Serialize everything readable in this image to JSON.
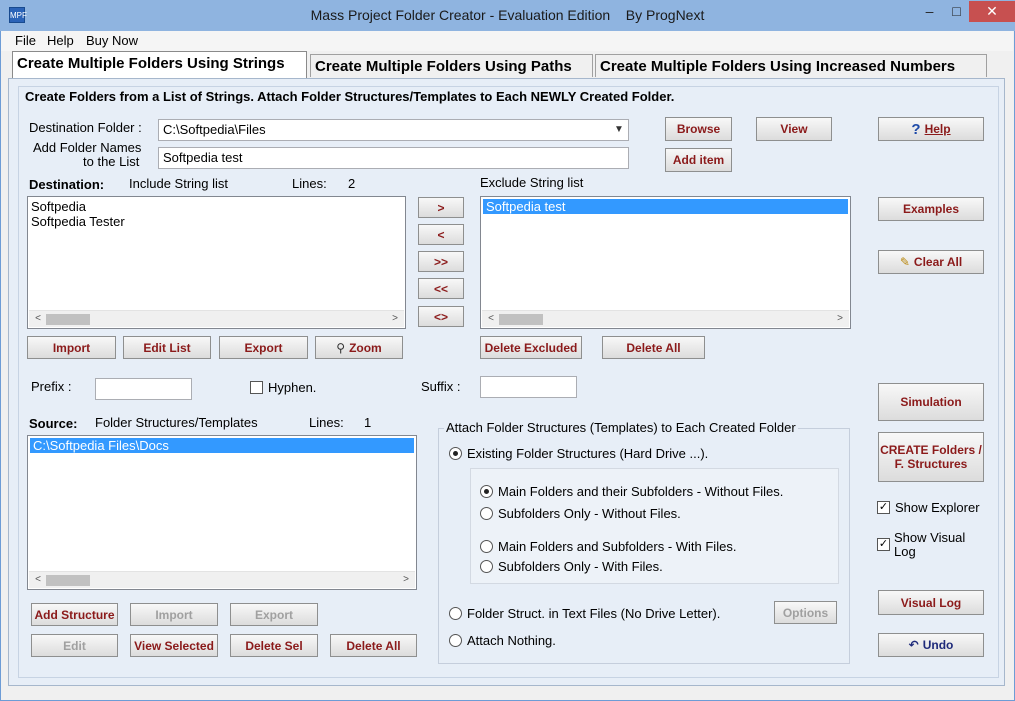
{
  "window": {
    "app_icon_label": "MPF",
    "title": "Mass Project Folder Creator - Evaluation Edition    By ProgNext",
    "minimize": "–",
    "maximize": "□",
    "close": "✕"
  },
  "menu": [
    "File",
    "Help",
    "Buy Now"
  ],
  "tabs": [
    "Create Multiple Folders Using Strings",
    "Create Multiple Folders Using Paths",
    "Create Multiple Folders Using Increased Numbers"
  ],
  "header_text": "Create Folders from a List of Strings. Attach Folder Structures/Templates to Each NEWLY Created Folder.",
  "destination_folder": {
    "label": "Destination Folder :",
    "value": "C:\\Softpedia\\Files"
  },
  "add_names": {
    "label_line1": "Add Folder Names",
    "label_line2": "to the List",
    "value": "Softpedia test"
  },
  "buttons": {
    "browse": "Browse",
    "view": "View",
    "help": "Help",
    "add_item": "Add item",
    "examples": "Examples",
    "clear_all": "Clear All",
    "move_right": ">",
    "move_left": "<",
    "move_all_right": ">>",
    "move_all_left": "<<",
    "swap": "<>",
    "import": "Import",
    "edit_list": "Edit List",
    "export": "Export",
    "zoom": "Zoom",
    "delete_excluded": "Delete Excluded",
    "delete_all_excluded": "Delete All",
    "simulation": "Simulation",
    "create_folders_line1": "CREATE Folders /",
    "create_folders_line2": "F. Structures",
    "visual_log": "Visual Log",
    "undo": "Undo",
    "add_structure": "Add Structure",
    "import_structure": "Import",
    "export_structure": "Export",
    "edit_structure": "Edit",
    "view_selected": "View Selected",
    "delete_sel": "Delete Sel",
    "delete_all_structures": "Delete All",
    "options": "Options"
  },
  "include_list": {
    "heading": "Destination:",
    "title": "Include String list",
    "lines_label": "Lines:",
    "lines_count": "2",
    "items": [
      "Softpedia",
      "Softpedia Tester"
    ]
  },
  "exclude_list": {
    "title": "Exclude String list",
    "items": [
      "Softpedia test"
    ]
  },
  "prefix": {
    "label": "Prefix :",
    "value": ""
  },
  "hyphen": {
    "label": "Hyphen.",
    "checked": false
  },
  "suffix": {
    "label": "Suffix :",
    "value": ""
  },
  "source": {
    "heading": "Source:",
    "title": "Folder Structures/Templates",
    "lines_label": "Lines:",
    "lines_count": "1",
    "items": [
      "C:\\Softpedia Files\\Docs"
    ]
  },
  "attach": {
    "title": "Attach Folder Structures (Templates) to Each Created Folder",
    "existing": "Existing Folder Structures (Hard Drive ...).",
    "sub_options": [
      "Main Folders and their Subfolders - Without Files.",
      "Subfolders Only - Without Files.",
      "Main Folders and Subfolders - With Files.",
      "Subfolders Only - With Files."
    ],
    "text_files": "Folder Struct. in Text Files (No Drive Letter).",
    "nothing": "Attach Nothing."
  },
  "options_right": {
    "show_explorer": "Show Explorer",
    "show_visual_log": "Show Visual Log"
  }
}
